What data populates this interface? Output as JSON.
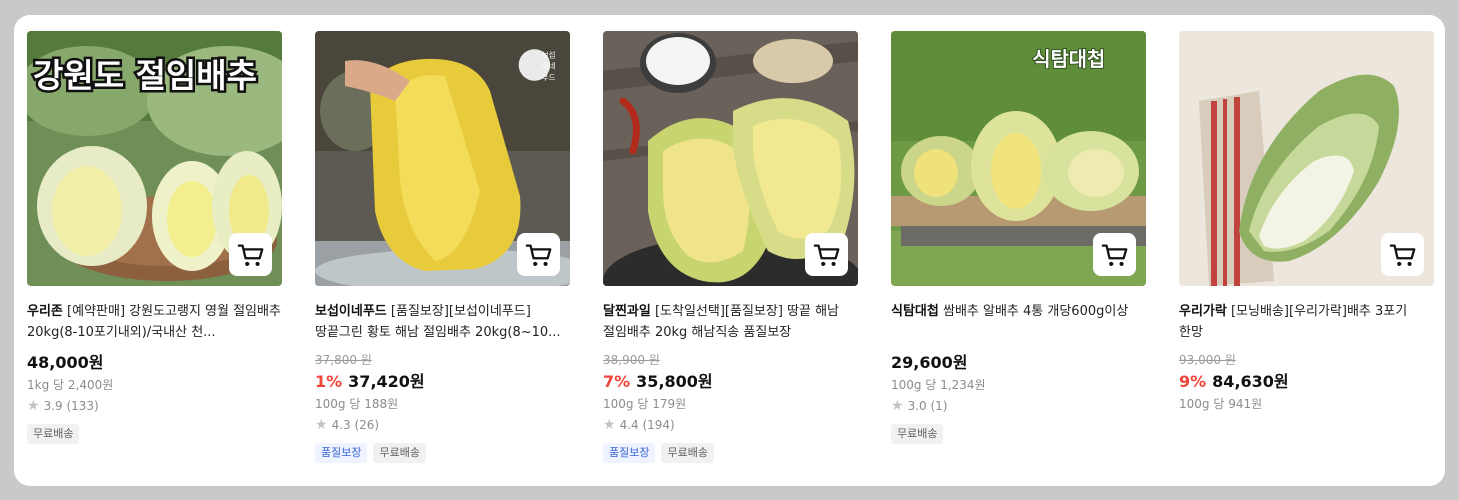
{
  "colors": {
    "panel_bg": "#ffffff",
    "page_bg": "#c9c9c9",
    "discount": "#f0453a",
    "quality_badge_text": "#3a66d6"
  },
  "cart_icon": "shopping-cart-icon",
  "star_icon": "star-icon",
  "products": [
    {
      "image_text": "강원도 절임배추",
      "brand": "우리존",
      "title": "[예약판매] 강원도고랭지 영월 절임배추 20kg(8-10포기내외)/국내산 천...",
      "original_price": "",
      "discount": "",
      "price": "48,000원",
      "unit_price": "1kg 당 2,400원",
      "rating": "3.9 (133)",
      "badges": [
        "무료배송"
      ]
    },
    {
      "image_text": "보섭이네푸드",
      "brand": "보섭이네푸드",
      "title": "[품질보장][보섭이네푸드]땅끝그린 황토 해남 절임배추 20kg(8~10...",
      "original_price": "37,800 원",
      "discount": "1%",
      "price": "37,420원",
      "unit_price": "100g 당 188원",
      "rating": "4.3 (26)",
      "badges": [
        "품질보장",
        "무료배송"
      ]
    },
    {
      "image_text": "",
      "brand": "달찐과일",
      "title": "[도착일선택][품질보장] 땅끝 해남 절임배추 20kg 해남직송 품질보장",
      "original_price": "38,900 원",
      "discount": "7%",
      "price": "35,800원",
      "unit_price": "100g 당 179원",
      "rating": "4.4 (194)",
      "badges": [
        "품질보장",
        "무료배송"
      ]
    },
    {
      "image_text": "식탐대첩",
      "brand": "식탐대첩",
      "title": "쌈배추 알배추 4통 개당600g이상",
      "original_price": "",
      "discount": "",
      "price": "29,600원",
      "unit_price": "100g 당 1,234원",
      "rating": "3.0 (1)",
      "badges": [
        "무료배송"
      ]
    },
    {
      "image_text": "",
      "brand": "우리가락",
      "title": "[모닝배송][우리가락]배추 3포기 한망",
      "original_price": "93,000 원",
      "discount": "9%",
      "price": "84,630원",
      "unit_price": "100g 당 941원",
      "rating": "",
      "badges": []
    }
  ]
}
